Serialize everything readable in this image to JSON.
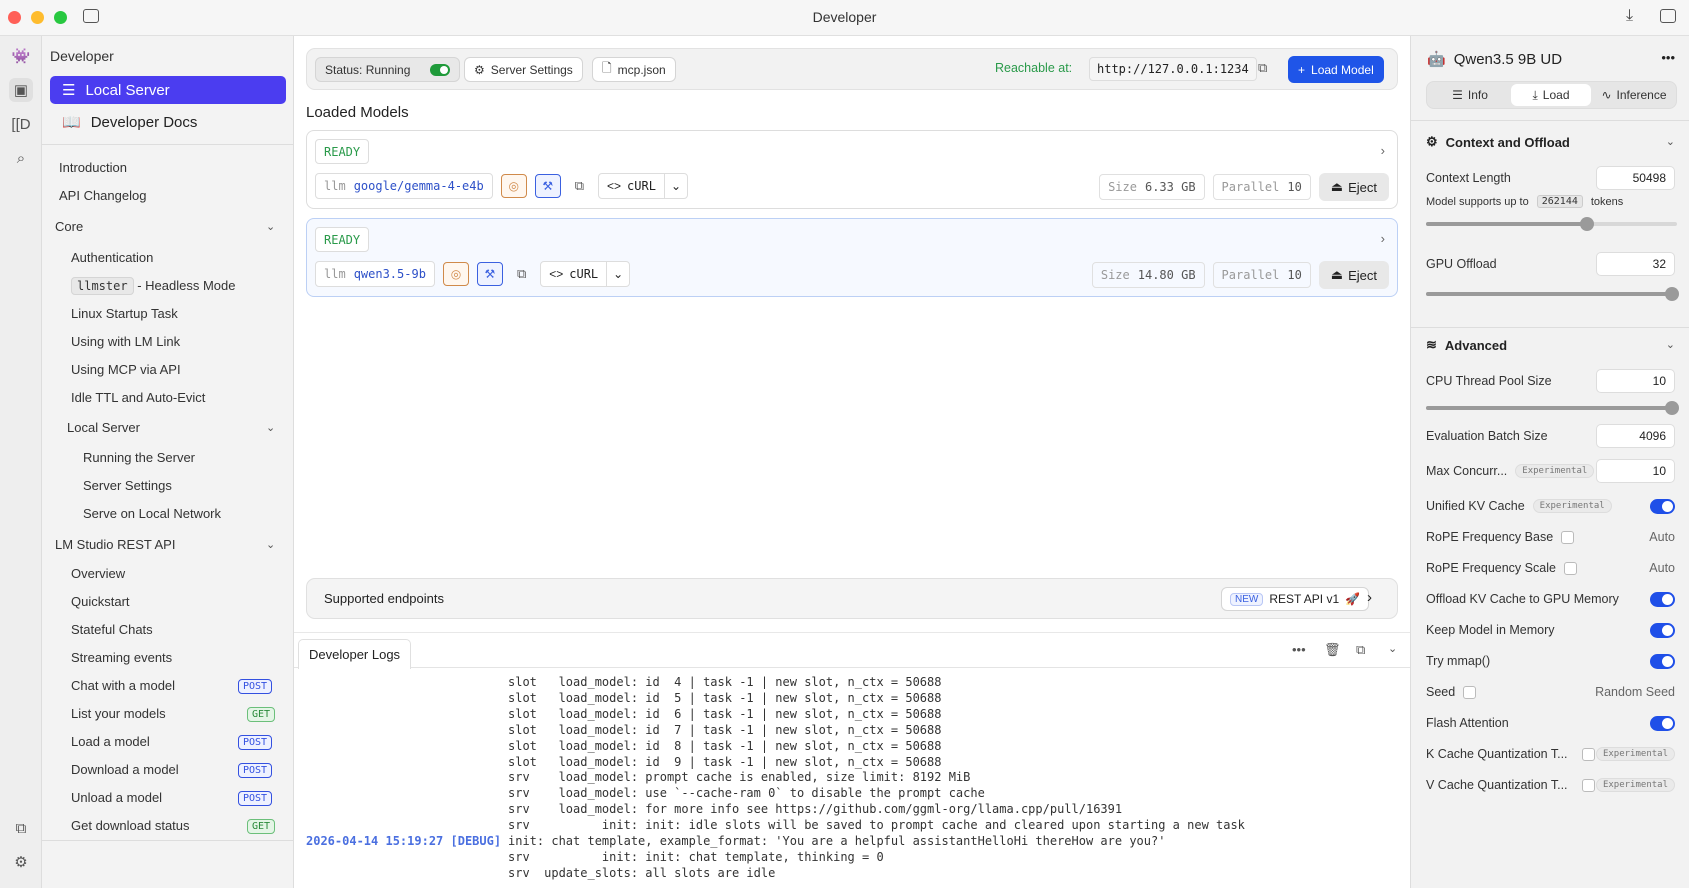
{
  "window": {
    "title": "Developer"
  },
  "sidebar": {
    "header": "Developer",
    "nav": [
      {
        "label": "Local Server",
        "icon": "server-icon",
        "active": true
      },
      {
        "label": "Developer Docs",
        "icon": "book-icon"
      }
    ],
    "docs": {
      "introduction": "Introduction",
      "api_changelog": "API Changelog",
      "core": {
        "label": "Core",
        "items": [
          "Authentication",
          "Linux Startup Task",
          "Using with LM Link",
          "Using MCP via API",
          "Idle TTL and Auto-Evict"
        ],
        "llmster_code": "llmster",
        "llmster_suffix": "- Headless Mode"
      },
      "local_server": {
        "label": "Local Server",
        "items": [
          "Running the Server",
          "Server Settings",
          "Serve on Local Network"
        ]
      },
      "rest_api": {
        "label": "LM Studio REST API",
        "items": [
          {
            "label": "Overview"
          },
          {
            "label": "Quickstart"
          },
          {
            "label": "Stateful Chats"
          },
          {
            "label": "Streaming events"
          },
          {
            "label": "Chat with a model",
            "method": "POST"
          },
          {
            "label": "List your models",
            "method": "GET"
          },
          {
            "label": "Load a model",
            "method": "POST"
          },
          {
            "label": "Download a model",
            "method": "POST"
          },
          {
            "label": "Unload a model",
            "method": "POST"
          },
          {
            "label": "Get download status",
            "method": "GET"
          }
        ]
      }
    }
  },
  "toolbar": {
    "status": "Status: Running",
    "server_settings": "Server Settings",
    "mcp_json": "mcp.json",
    "reachable_label": "Reachable at:",
    "url": "http://127.0.0.1:1234",
    "load_model": "Load Model"
  },
  "loaded_models": {
    "title": "Loaded Models",
    "models": [
      {
        "status": "READY",
        "type": "llm",
        "id": "google/gemma-4-e4b",
        "curl": "cURL",
        "size_label": "Size",
        "size": "6.33 GB",
        "parallel_label": "Parallel",
        "parallel": "10",
        "eject": "Eject"
      },
      {
        "status": "READY",
        "type": "llm",
        "id": "qwen3.5-9b",
        "curl": "cURL",
        "size_label": "Size",
        "size": "14.80 GB",
        "parallel_label": "Parallel",
        "parallel": "10",
        "eject": "Eject"
      }
    ]
  },
  "endpoints": {
    "label": "Supported endpoints",
    "new_badge": "NEW",
    "rest_api": "REST API v1"
  },
  "logs": {
    "tab": "Developer Logs",
    "lines": [
      {
        "ts": "",
        "text": "slot   load_model: id  4 | task -1 | new slot, n_ctx = 50688"
      },
      {
        "ts": "",
        "text": "slot   load_model: id  5 | task -1 | new slot, n_ctx = 50688"
      },
      {
        "ts": "",
        "text": "slot   load_model: id  6 | task -1 | new slot, n_ctx = 50688"
      },
      {
        "ts": "",
        "text": "slot   load_model: id  7 | task -1 | new slot, n_ctx = 50688"
      },
      {
        "ts": "",
        "text": "slot   load_model: id  8 | task -1 | new slot, n_ctx = 50688"
      },
      {
        "ts": "",
        "text": "slot   load_model: id  9 | task -1 | new slot, n_ctx = 50688"
      },
      {
        "ts": "",
        "text": "srv    load_model: prompt cache is enabled, size limit: 8192 MiB"
      },
      {
        "ts": "",
        "text": "srv    load_model: use `--cache-ram 0` to disable the prompt cache"
      },
      {
        "ts": "",
        "text": "srv    load_model: for more info see https://github.com/ggml-org/llama.cpp/pull/16391"
      },
      {
        "ts": "",
        "text": "srv          init: init: idle slots will be saved to prompt cache and cleared upon starting a new task"
      },
      {
        "ts": "2026-04-14 15:19:27 [DEBUG]",
        "text": "init: chat template, example_format: 'You are a helpful assistantHelloHi thereHow are you?'"
      },
      {
        "ts": "",
        "text": "srv          init: init: chat template, thinking = 0"
      },
      {
        "ts": "",
        "text": "srv  update_slots: all slots are idle"
      }
    ]
  },
  "right_panel": {
    "model_name": "Qwen3.5 9B UD",
    "tabs": [
      "Info",
      "Load",
      "Inference"
    ],
    "active_tab": "Load",
    "context": {
      "title": "Context and Offload",
      "context_length_label": "Context Length",
      "context_length": "50498",
      "supports_prefix": "Model supports up to",
      "max_tokens": "262144",
      "supports_suffix": "tokens",
      "context_fraction": 0.193,
      "gpu_offload_label": "GPU Offload",
      "gpu_offload": "32",
      "gpu_fraction": 1.0
    },
    "advanced": {
      "title": "Advanced",
      "cpu_thread_label": "CPU Thread Pool Size",
      "cpu_thread": "10",
      "cpu_fraction": 1.0,
      "eval_batch_label": "Evaluation Batch Size",
      "eval_batch": "4096",
      "max_concurrent_label": "Max Concurr...",
      "max_concurrent": "10",
      "experimental": "Experimental",
      "unified_kv_label": "Unified KV Cache",
      "rope_base_label": "RoPE Frequency Base",
      "rope_scale_label": "RoPE Frequency Scale",
      "auto": "Auto",
      "offload_kv_label": "Offload KV Cache to GPU Memory",
      "keep_model_label": "Keep Model in Memory",
      "mmap_label": "Try mmap()",
      "seed_label": "Seed",
      "seed_value": "Random Seed",
      "flash_label": "Flash Attention",
      "k_cache_label": "K Cache Quantization T...",
      "v_cache_label": "V Cache Quantization T..."
    }
  },
  "colors": {
    "accent": "#4b3df0",
    "primary_button": "#1f55e8",
    "ready": "#2a9a4a",
    "toggle_on": "#1f4fe8"
  }
}
